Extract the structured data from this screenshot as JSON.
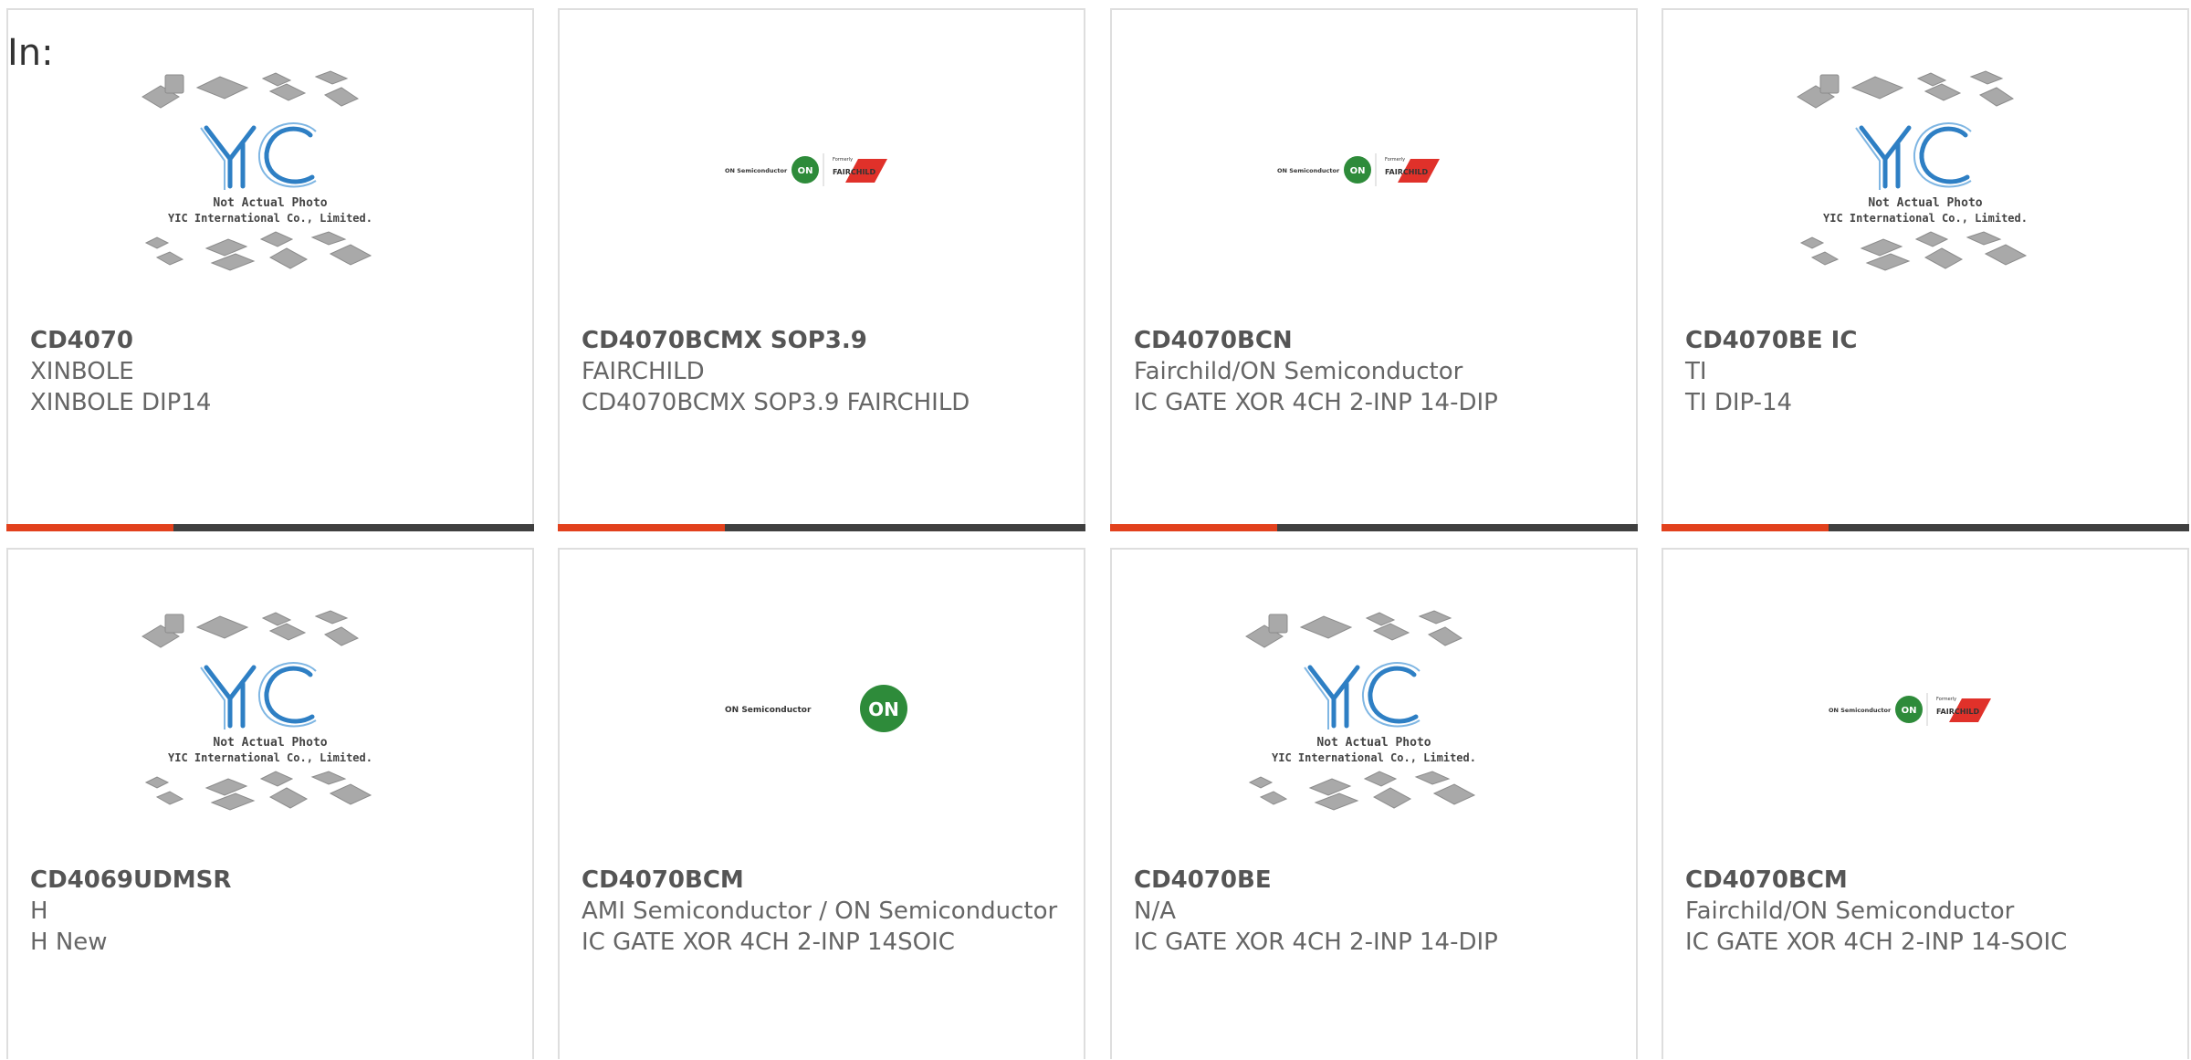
{
  "filter": {
    "label": "In:"
  },
  "colors": {
    "accent": "#e2411d",
    "bar": "#3f3f3f",
    "border": "#dedede",
    "yic_blue": "#2e7fc4",
    "on_green": "#2e8b3a",
    "fairchild_red": "#e0312a"
  },
  "placeholder": {
    "line1": "Not Actual Photo",
    "line2": "YIC International Co., Limited."
  },
  "brand_logos": {
    "on_semi": "ON Semiconductor",
    "on_badge": "ON",
    "formerly": "Formerly",
    "fairchild": "FAIRCHILD"
  },
  "products": [
    {
      "part_no": "CD4070",
      "maker": "XINBOLE",
      "desc": "XINBOLE DIP14",
      "image": "yic-placeholder-icon"
    },
    {
      "part_no": "CD4070BCMX SOP3.9",
      "maker": "FAIRCHILD",
      "desc": "CD4070BCMX SOP3.9 FAIRCHILD",
      "image": "on-fairchild-logo"
    },
    {
      "part_no": "CD4070BCN",
      "maker": "Fairchild/ON Semiconductor",
      "desc": "IC GATE XOR 4CH 2-INP 14-DIP",
      "image": "on-fairchild-logo"
    },
    {
      "part_no": "CD4070BE IC",
      "maker": "TI",
      "desc": "TI DIP-14",
      "image": "yic-placeholder-icon"
    },
    {
      "part_no": "CD4069UDMSR",
      "maker": "H",
      "desc": "H New",
      "image": "yic-placeholder-icon"
    },
    {
      "part_no": "CD4070BCM",
      "maker": "AMI Semiconductor / ON Semiconductor",
      "desc": "IC GATE XOR 4CH 2-INP 14SOIC",
      "image": "on-semi-logo"
    },
    {
      "part_no": "CD4070BE",
      "maker": "N/A",
      "desc": "IC GATE XOR 4CH 2-INP 14-DIP",
      "image": "yic-placeholder-icon"
    },
    {
      "part_no": "CD4070BCM",
      "maker": "Fairchild/ON Semiconductor",
      "desc": "IC GATE XOR 4CH 2-INP 14-SOIC",
      "image": "on-fairchild-logo"
    }
  ]
}
